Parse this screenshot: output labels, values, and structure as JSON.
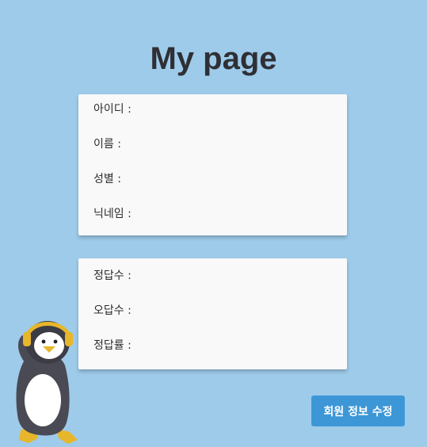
{
  "page": {
    "title": "My page"
  },
  "profile": {
    "fields": [
      {
        "label": "아이디 :"
      },
      {
        "label": "이름 :"
      },
      {
        "label": "성별 :"
      },
      {
        "label": "닉네임 :"
      }
    ]
  },
  "stats": {
    "fields": [
      {
        "label": "정답수 :"
      },
      {
        "label": "오답수 :"
      },
      {
        "label": "정답률 :"
      }
    ]
  },
  "actions": {
    "edit_label": "회원 정보 수정"
  },
  "colors": {
    "background": "#9ecbea",
    "card": "#f9f9f9",
    "button": "#3d97d6",
    "title": "#2f2f35"
  }
}
